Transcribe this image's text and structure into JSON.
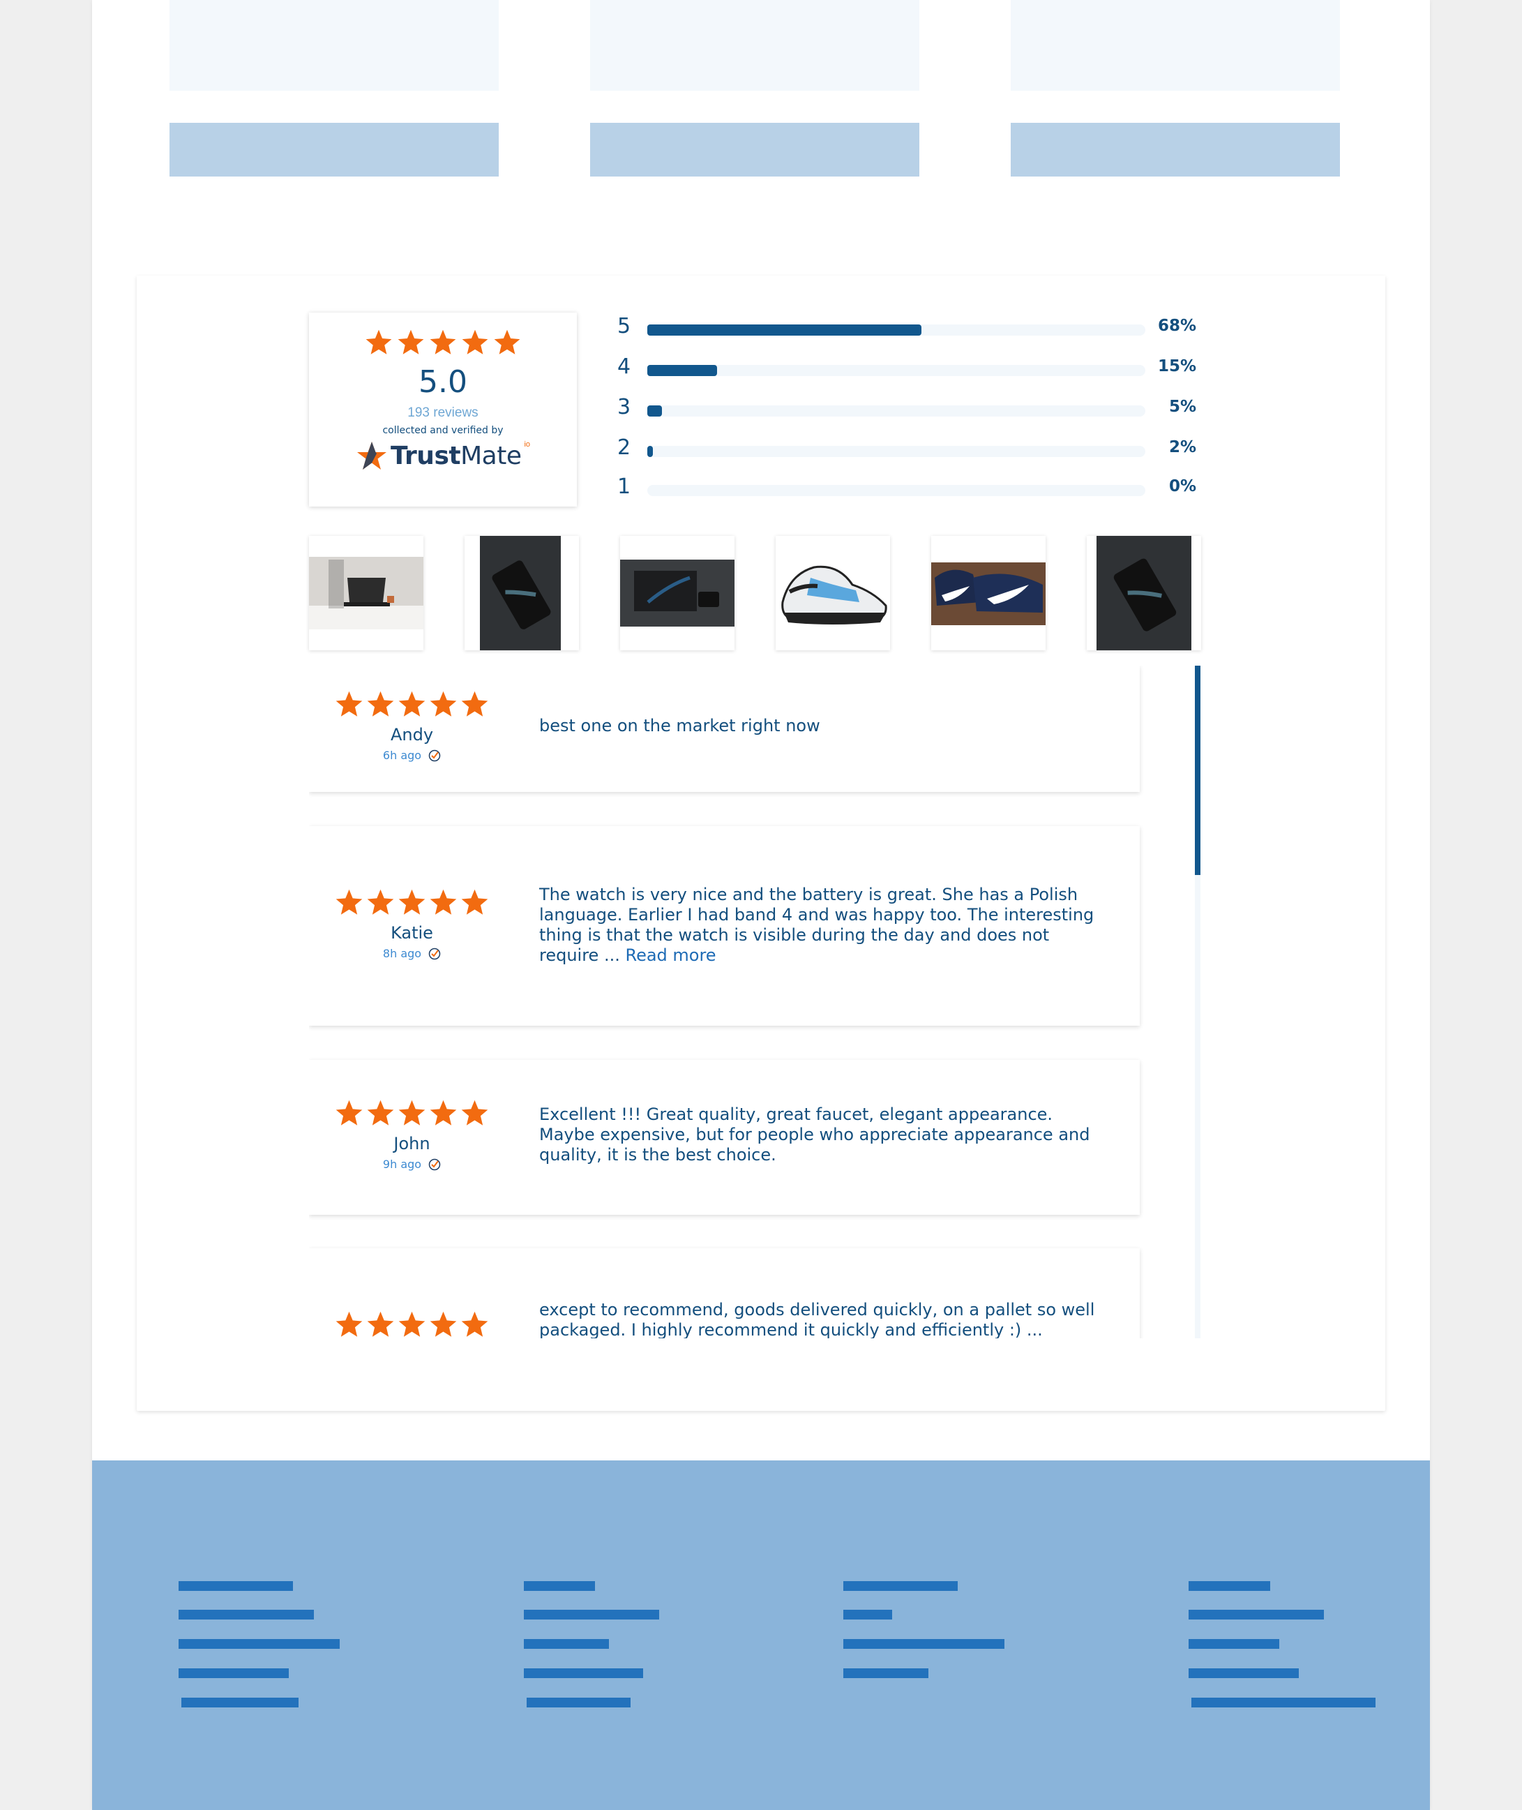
{
  "colors": {
    "star": "#f26b10",
    "primary_text": "#144f7e",
    "bar_fill": "#11578d",
    "footer_bg": "#8ab4da",
    "footer_bar": "#2372bc"
  },
  "summary": {
    "score": "5.0",
    "stars": 5,
    "reviews_count": "193 reviews",
    "collected_text": "collected and verified by",
    "brand_part1": "Trust",
    "brand_part2": "Mate",
    "brand_sup": "io"
  },
  "distribution": [
    {
      "stars": "5",
      "percent_label": "68%",
      "fraction": 0.55
    },
    {
      "stars": "4",
      "percent_label": "15%",
      "fraction": 0.14
    },
    {
      "stars": "3",
      "percent_label": "5%",
      "fraction": 0.03
    },
    {
      "stars": "2",
      "percent_label": "2%",
      "fraction": 0.01
    },
    {
      "stars": "1",
      "percent_label": "0%",
      "fraction": 0
    }
  ],
  "photos": [
    {
      "name": "laptop-desk-photo"
    },
    {
      "name": "phone-photo"
    },
    {
      "name": "laptop-dark-photo"
    },
    {
      "name": "sneaker-photo"
    },
    {
      "name": "shoes-worn-photo"
    },
    {
      "name": "phone-photo-2"
    }
  ],
  "reviews": [
    {
      "name": "Andy",
      "time": "6h ago",
      "stars": 5,
      "text": "best one on the market right now",
      "read_more": ""
    },
    {
      "name": "Katie",
      "time": "8h ago",
      "stars": 5,
      "text": "The watch is very nice and the battery is great. She has a Polish language. Earlier I had band 4 and was happy too. The interesting thing is that the watch is visible during the day and does not require ... ",
      "read_more": "Read more"
    },
    {
      "name": "John",
      "time": "9h ago",
      "stars": 5,
      "text": "Excellent !!! Great quality, great faucet, elegant appearance. Maybe expensive, but for people who appreciate appearance and quality, it is the best choice.",
      "read_more": ""
    },
    {
      "name": "",
      "time": "",
      "stars": 5,
      "text": "except to recommend, goods delivered quickly, on a pallet so well packaged. I highly recommend it quickly and efficiently :) ...",
      "read_more": ""
    }
  ]
}
